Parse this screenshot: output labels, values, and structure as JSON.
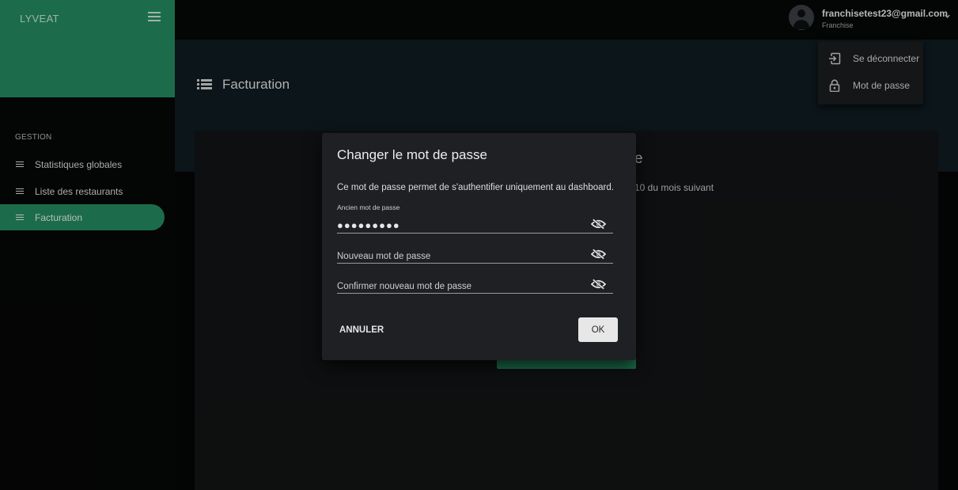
{
  "app": {
    "brand": "LYVEAT"
  },
  "sidebar": {
    "section": "GESTION",
    "items": [
      {
        "label": "Statistiques globales",
        "icon": "list-icon"
      },
      {
        "label": "Liste des restaurants",
        "icon": "list-icon"
      },
      {
        "label": "Facturation",
        "icon": "list-icon",
        "active": true
      }
    ]
  },
  "user": {
    "email": "franchisetest23@gmail.com",
    "role": "Franchise"
  },
  "user_menu": {
    "items": [
      {
        "label": "Se déconnecter",
        "icon": "logout-icon"
      },
      {
        "label": "Mot de passe",
        "icon": "lock-icon"
      }
    ]
  },
  "page": {
    "title": "Facturation",
    "heading_fragment": "e",
    "text_fragment": "10 du mois suivant"
  },
  "dialog": {
    "title": "Changer le mot de passe",
    "description": "Ce mot de passe permet de s'authentifier uniquement au dashboard.",
    "fields": [
      {
        "label": "Ancien mot de passe",
        "value": "●●●●●●●●●",
        "placeholder": ""
      },
      {
        "label": "",
        "value": "",
        "placeholder": "Nouveau mot de passe"
      },
      {
        "label": "",
        "value": "",
        "placeholder": "Confirmer nouveau mot de passe"
      }
    ],
    "cancel_label": "ANNULER",
    "ok_label": "OK"
  },
  "colors": {
    "accent": "#258b61",
    "background": "#050606",
    "dialog": "#1e2023",
    "header_band": "#0f1b22"
  }
}
